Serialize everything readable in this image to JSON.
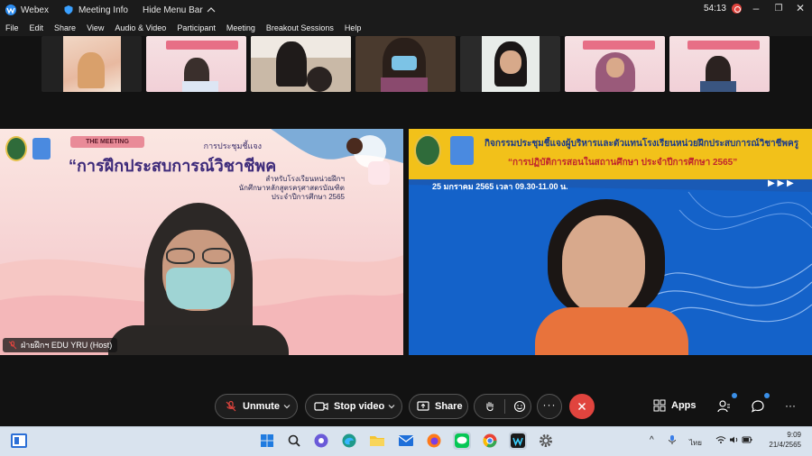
{
  "titlebar": {
    "app_name": "Webex",
    "meeting_info": "Meeting Info",
    "hide_menu": "Hide Menu Bar",
    "timer": "54:13"
  },
  "menu": [
    "File",
    "Edit",
    "Share",
    "View",
    "Audio & Video",
    "Participant",
    "Meeting",
    "Breakout Sessions",
    "Help"
  ],
  "left_video": {
    "banner_tag": "THE MEETING",
    "heading_small": "การประชุมชี้แจง",
    "heading_big": "“การฝึกประสบการณ์วิชาชีพครู”",
    "line1": "สำหรับโรงเรียนหน่วยฝึกฯ",
    "line2": "นักศึกษาหลักสูตรครุศาสตรบัณฑิต",
    "line3": "ประจำปีการศึกษา 2565",
    "name_label": "ฝ่ายฝึกฯ EDU YRU (Host)"
  },
  "right_video": {
    "title1": "กิจกรรมประชุมชี้แจงผู้บริหารและตัวแทนโรงเรียนหน่วยฝึกประสบการณ์วิชาชีพครู",
    "title2": "“การปฏิบัติการสอนในสถานศึกษา ประจำปีการศึกษา 2565”",
    "date_line": "25 มกราคม 2565  เวลา 09.30-11.00 น."
  },
  "controls": {
    "unmute": "Unmute",
    "stop_video": "Stop video",
    "share": "Share",
    "apps": "Apps"
  },
  "taskbar": {
    "time": "9:09",
    "date": "21/4/2565",
    "lang": "ไทย"
  },
  "colors": {
    "end_call": "#e0443e",
    "accent_blue": "#1565c0",
    "banner_yellow": "#f2c11a"
  }
}
